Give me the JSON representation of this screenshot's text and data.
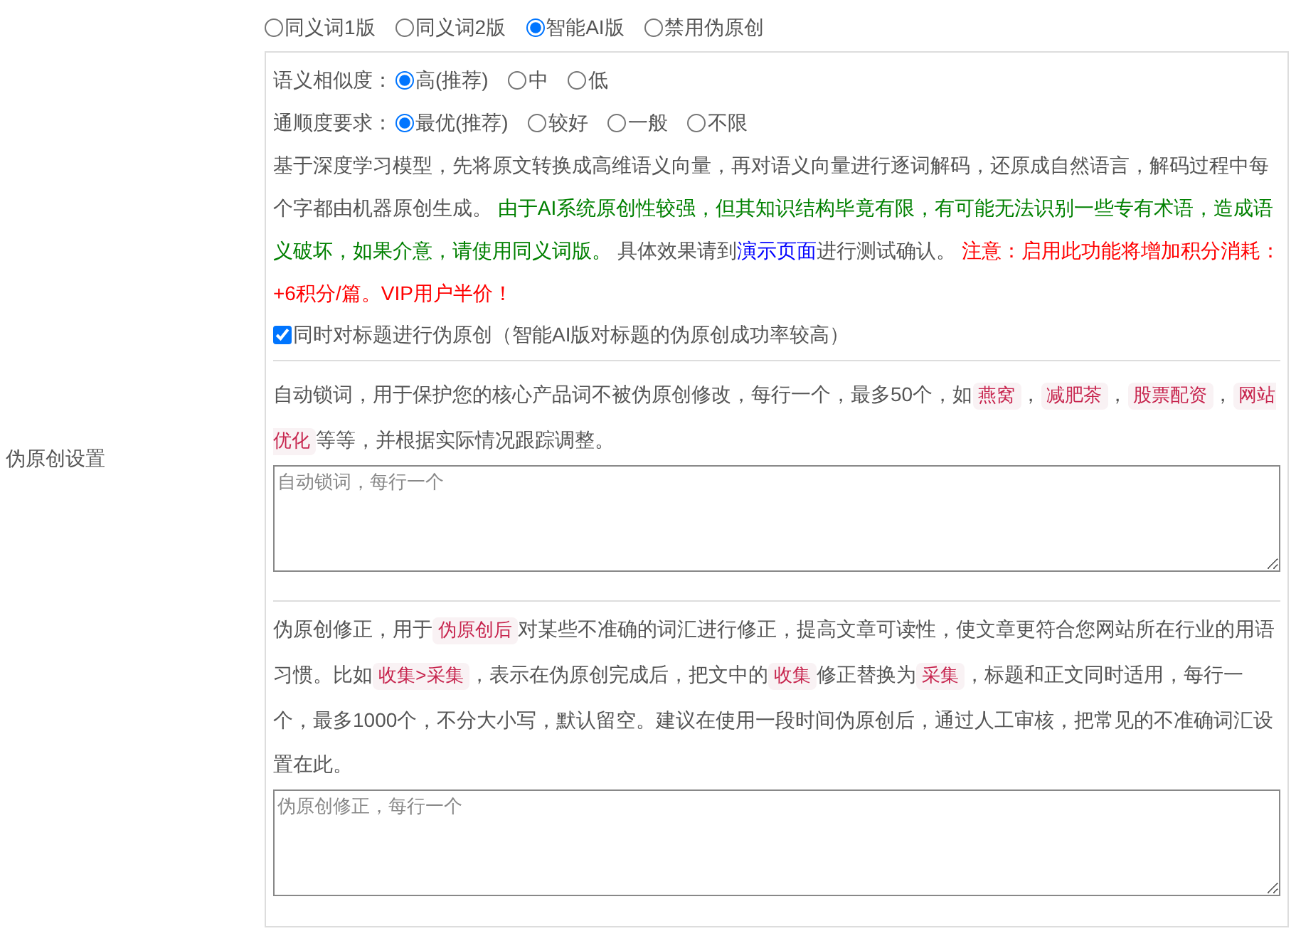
{
  "section_label": "伪原创设置",
  "modes": [
    {
      "label": "同义词1版",
      "selected": false
    },
    {
      "label": "同义词2版",
      "selected": false
    },
    {
      "label": "智能AI版",
      "selected": true
    },
    {
      "label": "禁用伪原创",
      "selected": false
    }
  ],
  "similarity": {
    "label": "语义相似度：",
    "options": [
      {
        "label": "高(推荐)",
        "selected": true
      },
      {
        "label": "中",
        "selected": false
      },
      {
        "label": "低",
        "selected": false
      }
    ]
  },
  "fluency": {
    "label": "通顺度要求：",
    "options": [
      {
        "label": "最优(推荐)",
        "selected": true
      },
      {
        "label": "较好",
        "selected": false
      },
      {
        "label": "一般",
        "selected": false
      },
      {
        "label": "不限",
        "selected": false
      }
    ]
  },
  "ai_note": [
    {
      "kind": "plain",
      "text": "基于深度学习模型，先将原文转换成高维语义向量，再对语义向量进行逐词解码，还原成自然语言，解码过程中每个字都由机器原创生成。 "
    },
    {
      "kind": "green",
      "text": "由于AI系统原创性较强，但其知识结构毕竟有限，有可能无法识别一些专有术语，造成语义破坏，如果介意，请使用同义词版。"
    },
    {
      "kind": "plain",
      "text": " 具体效果请到"
    },
    {
      "kind": "link",
      "text": "演示页面"
    },
    {
      "kind": "plain",
      "text": "进行测试确认。 "
    },
    {
      "kind": "red",
      "text": "注意：启用此功能将增加积分消耗：+6积分/篇。VIP用户半价！"
    }
  ],
  "title_option": {
    "label": "同时对标题进行伪原创（智能AI版对标题的伪原创成功率较高）",
    "checked": true
  },
  "lock_words": {
    "text": [
      {
        "kind": "plain",
        "text": "自动锁词，用于保护您的核心产品词不被伪原创修改，每行一个，最多50个，如"
      },
      {
        "kind": "code",
        "text": "燕窝"
      },
      {
        "kind": "plain",
        "text": "，"
      },
      {
        "kind": "code",
        "text": "减肥茶"
      },
      {
        "kind": "plain",
        "text": "，"
      },
      {
        "kind": "code",
        "text": "股票配资"
      },
      {
        "kind": "plain",
        "text": "，"
      },
      {
        "kind": "code",
        "text": "网站优化"
      },
      {
        "kind": "plain",
        "text": "等等，并根据实际情况跟踪调整。"
      }
    ],
    "placeholder": "自动锁词，每行一个"
  },
  "correction": {
    "text": [
      {
        "kind": "plain",
        "text": "伪原创修正，用于"
      },
      {
        "kind": "code",
        "text": "伪原创后"
      },
      {
        "kind": "plain",
        "text": "对某些不准确的词汇进行修正，提高文章可读性，使文章更符合您网站所在行业的用语习惯。比如"
      },
      {
        "kind": "code",
        "text": "收集>采集"
      },
      {
        "kind": "plain",
        "text": "，表示在伪原创完成后，把文中的"
      },
      {
        "kind": "code",
        "text": "收集"
      },
      {
        "kind": "plain",
        "text": "修正替换为"
      },
      {
        "kind": "code",
        "text": "采集"
      },
      {
        "kind": "plain",
        "text": "，标题和正文同时适用，每行一个，最多1000个，不分大小写，默认留空。建议在使用一段时间伪原创后，通过人工审核，把常见的不准确词汇设置在此。"
      }
    ],
    "placeholder": "伪原创修正，每行一个"
  }
}
